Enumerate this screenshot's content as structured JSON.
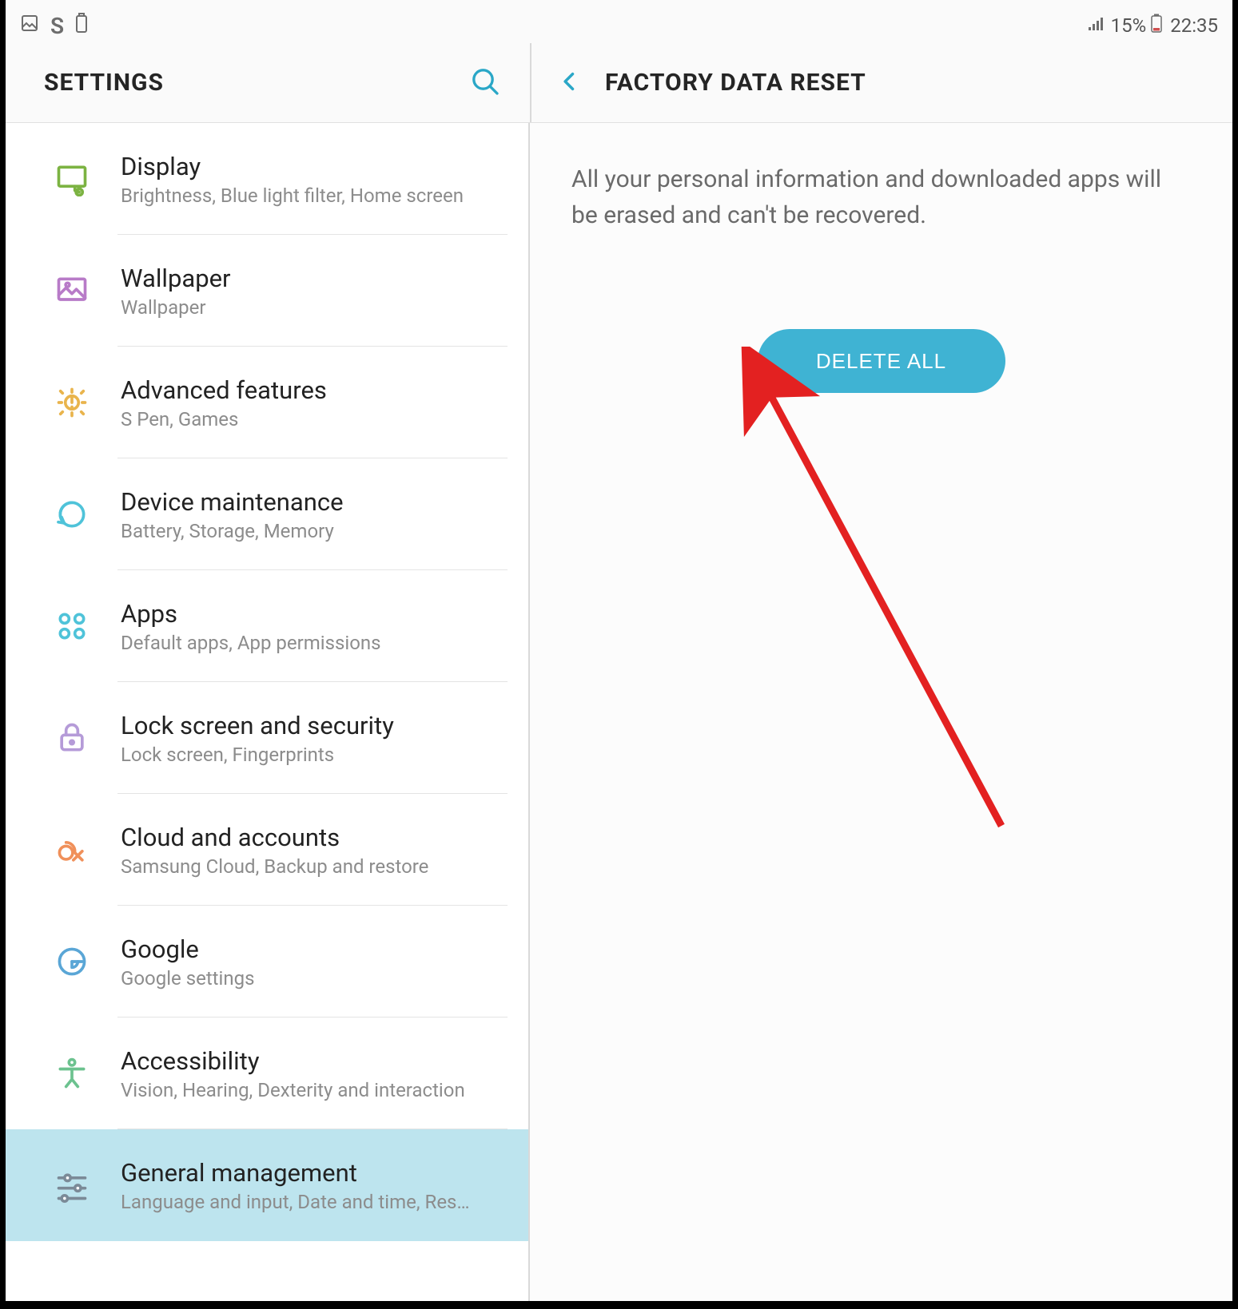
{
  "status_bar": {
    "battery_percent": "15%",
    "time": "22:35"
  },
  "left_header": {
    "title": "SETTINGS"
  },
  "right_header": {
    "title": "FACTORY DATA RESET"
  },
  "content": {
    "warning_text": "All your personal information and downloaded apps will be erased and can't be recovered.",
    "button_label": "DELETE ALL"
  },
  "sidebar": {
    "items": [
      {
        "id": "display",
        "title": "Display",
        "subtitle": "Brightness, Blue light filter, Home screen",
        "icon": "display",
        "selected": false
      },
      {
        "id": "wallpaper",
        "title": "Wallpaper",
        "subtitle": "Wallpaper",
        "icon": "wallpaper",
        "selected": false
      },
      {
        "id": "advanced-features",
        "title": "Advanced features",
        "subtitle": "S Pen, Games",
        "icon": "advanced",
        "selected": false
      },
      {
        "id": "device-maintenance",
        "title": "Device maintenance",
        "subtitle": "Battery, Storage, Memory",
        "icon": "maintenance",
        "selected": false
      },
      {
        "id": "apps",
        "title": "Apps",
        "subtitle": "Default apps, App permissions",
        "icon": "apps",
        "selected": false
      },
      {
        "id": "lock-screen",
        "title": "Lock screen and security",
        "subtitle": "Lock screen, Fingerprints",
        "icon": "lock",
        "selected": false
      },
      {
        "id": "cloud-accounts",
        "title": "Cloud and accounts",
        "subtitle": "Samsung Cloud, Backup and restore",
        "icon": "cloud",
        "selected": false
      },
      {
        "id": "google",
        "title": "Google",
        "subtitle": "Google settings",
        "icon": "google",
        "selected": false
      },
      {
        "id": "accessibility",
        "title": "Accessibility",
        "subtitle": "Vision, Hearing, Dexterity and interaction",
        "icon": "accessibility",
        "selected": false
      },
      {
        "id": "general-management",
        "title": "General management",
        "subtitle": "Language and input, Date and time, Res…",
        "icon": "sliders",
        "selected": true
      }
    ]
  },
  "icon_colors": {
    "display": "#7cb342",
    "wallpaper": "#b87bc8",
    "advanced": "#e9b44c",
    "maintenance": "#4fc3d9",
    "apps": "#4fc3d9",
    "lock": "#b59bd8",
    "cloud": "#f0905a",
    "google": "#5aa6d6",
    "accessibility": "#6cc28f",
    "sliders": "#7b8a97"
  },
  "annotation": {
    "arrow_color": "#e32121"
  }
}
